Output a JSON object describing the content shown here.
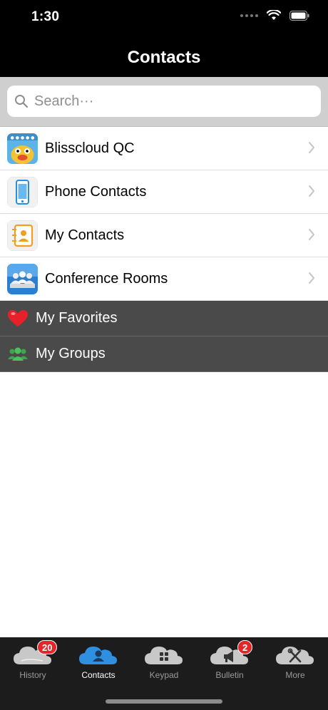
{
  "status_bar": {
    "time": "1:30"
  },
  "nav": {
    "title": "Contacts"
  },
  "search": {
    "placeholder": "Search···"
  },
  "rows": [
    {
      "label": "Blisscloud QC",
      "icon": "cartoon-avatar-icon"
    },
    {
      "label": "Phone Contacts",
      "icon": "phone-icon"
    },
    {
      "label": "My Contacts",
      "icon": "address-book-icon"
    },
    {
      "label": "Conference Rooms",
      "icon": "conference-icon"
    }
  ],
  "sections": [
    {
      "label": "My Favorites",
      "icon": "heart-icon"
    },
    {
      "label": "My Groups",
      "icon": "group-icon"
    }
  ],
  "tabs": [
    {
      "label": "History",
      "badge": "20",
      "icon": "history-cloud-icon"
    },
    {
      "label": "Contacts",
      "icon": "contacts-cloud-icon",
      "active": true
    },
    {
      "label": "Keypad",
      "icon": "keypad-cloud-icon"
    },
    {
      "label": "Bulletin",
      "badge": "2",
      "icon": "bulletin-cloud-icon"
    },
    {
      "label": "More",
      "icon": "tools-cloud-icon"
    }
  ],
  "colors": {
    "badge": "#e4262a",
    "active_tab_icon": "#2f8fe0",
    "section_bg": "#4a4a4a"
  }
}
